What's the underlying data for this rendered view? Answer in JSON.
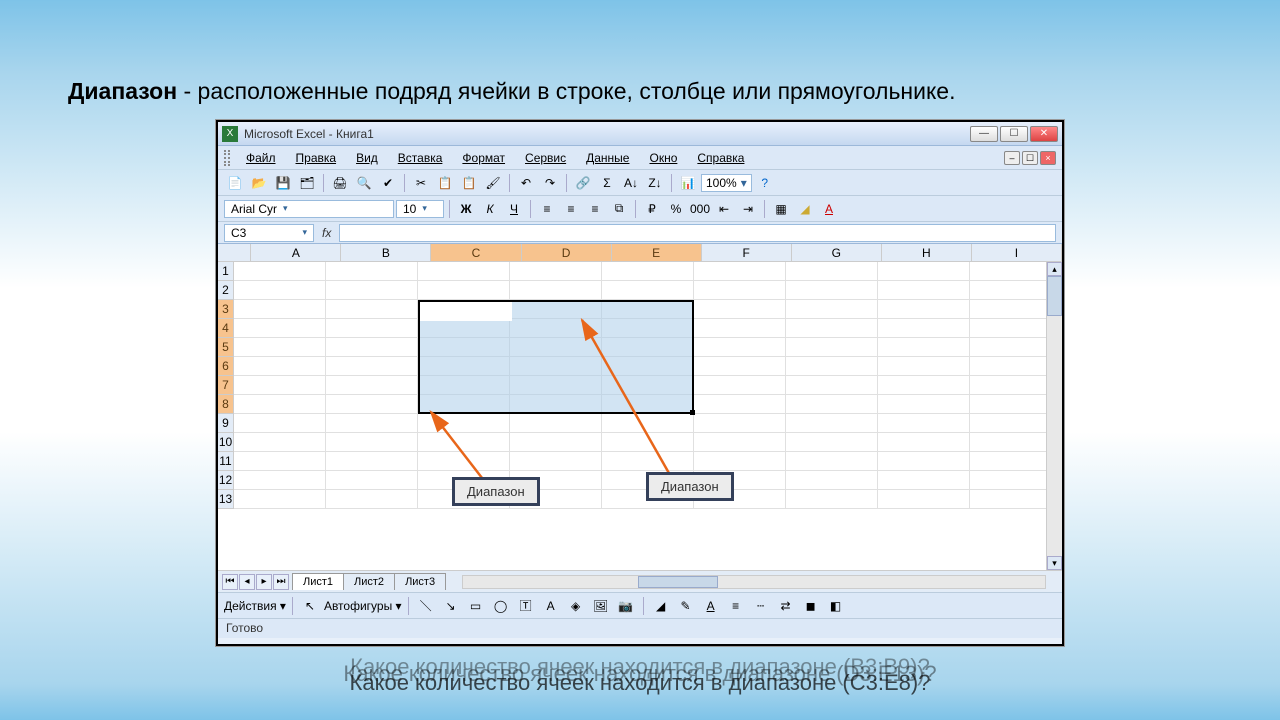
{
  "heading": {
    "term": "Диапазон",
    "definition": " - расположенные подряд ячейки в строке, столбце или прямоугольнике."
  },
  "window": {
    "title": "Microsoft Excel - Книга1",
    "menus": [
      "Файл",
      "Правка",
      "Вид",
      "Вставка",
      "Формат",
      "Сервис",
      "Данные",
      "Окно",
      "Справка"
    ],
    "zoom": "100%",
    "font_name": "Arial Cyr",
    "font_size": "10",
    "name_box": "C3",
    "fx": "fx",
    "columns": [
      "A",
      "B",
      "C",
      "D",
      "E",
      "F",
      "G",
      "H",
      "I"
    ],
    "selected_columns": [
      "C",
      "D",
      "E"
    ],
    "rows": [
      "1",
      "2",
      "3",
      "4",
      "5",
      "6",
      "7",
      "8",
      "9",
      "10",
      "11",
      "12",
      "13"
    ],
    "selected_rows": [
      "3",
      "4",
      "5",
      "6",
      "7",
      "8"
    ],
    "sheet_tabs": [
      "Лист1",
      "Лист2",
      "Лист3"
    ],
    "drawing_label": "Действия",
    "autoshapes_label": "Автофигуры",
    "status": "Готово"
  },
  "annotations": {
    "label1": "Диапазон",
    "label2": "Диапазон"
  },
  "questions": {
    "q1": "Какое количество ячеек находится в диапазоне (B3:B9)?",
    "q2": "Какое количество ячеек находится в диапазоне (C3:E8)?",
    "q3": "Какое количество ячеек находится в диапазоне (D3:E13)?"
  }
}
